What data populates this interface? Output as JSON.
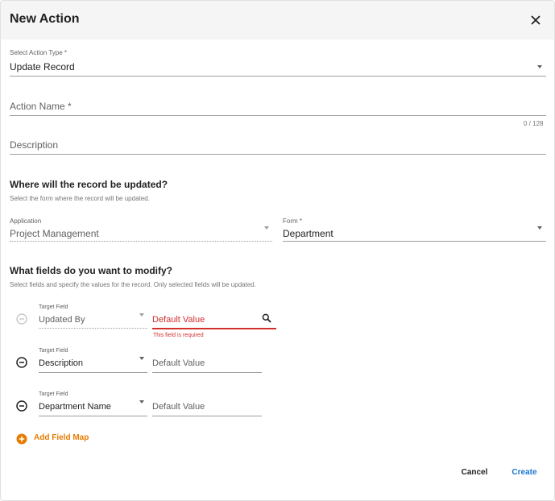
{
  "dialog": {
    "title": "New Action"
  },
  "action_type": {
    "label": "Select Action Type *",
    "value": "Update Record"
  },
  "action_name": {
    "placeholder": "Action Name *",
    "counter": "0 / 128"
  },
  "description": {
    "placeholder": "Description"
  },
  "where_section": {
    "title": "Where will the record be updated?",
    "subtitle": "Select the form where the record will be updated."
  },
  "application": {
    "label": "Application",
    "value": "Project Management"
  },
  "form": {
    "label": "Form *",
    "value": "Department"
  },
  "fields_section": {
    "title": "What fields do you want to modify?",
    "subtitle": "Select fields and specify the values for the record. Only selected fields will be updated."
  },
  "field_maps": [
    {
      "target_label": "Target Field",
      "target_value": "Updated By",
      "default_placeholder": "Default Value",
      "error": "This field is required"
    },
    {
      "target_label": "Target Field",
      "target_value": "Description",
      "default_placeholder": "Default Value"
    },
    {
      "target_label": "Target Field",
      "target_value": "Department Name",
      "default_placeholder": "Default Value"
    }
  ],
  "add_field_map": {
    "label": "Add Field Map"
  },
  "actions": {
    "cancel": "Cancel",
    "create": "Create"
  },
  "colors": {
    "accent_orange": "#e67c00",
    "error_red": "#d32f2f",
    "primary_blue": "#1976d2",
    "header_bg": "#f5f5f5"
  }
}
